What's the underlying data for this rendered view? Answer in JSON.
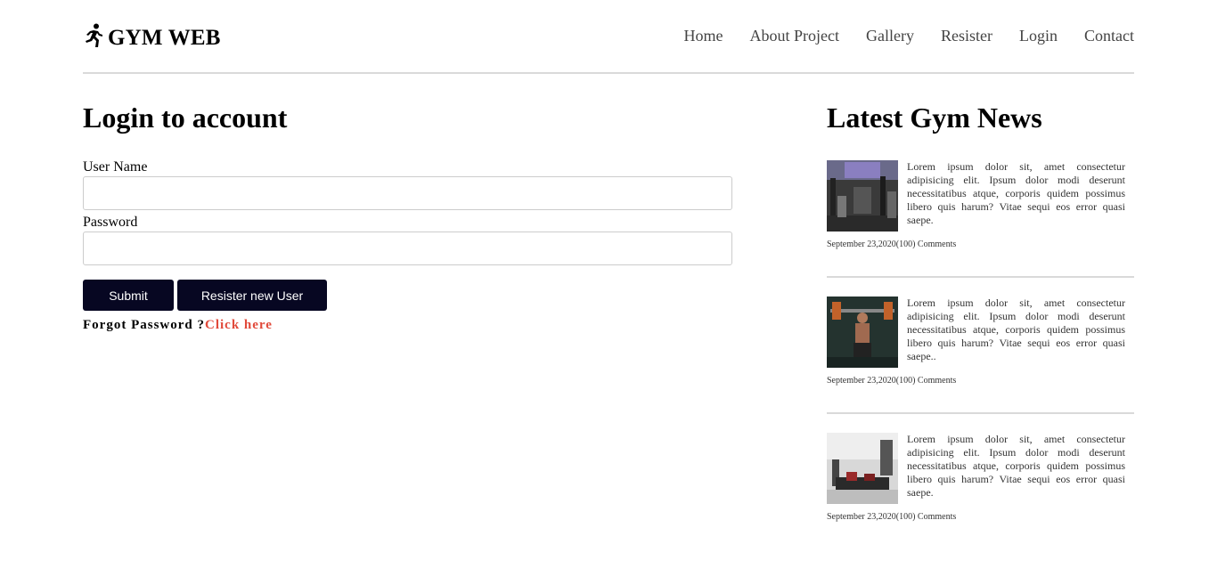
{
  "brand": {
    "name": "GYM WEB",
    "icon": "running-person-icon"
  },
  "nav": [
    {
      "label": "Home"
    },
    {
      "label": "About Project"
    },
    {
      "label": "Gallery"
    },
    {
      "label": "Resister"
    },
    {
      "label": "Login"
    },
    {
      "label": "Contact"
    }
  ],
  "login": {
    "title": "Login to account",
    "username_label": "User Name",
    "username_value": "",
    "password_label": "Password",
    "password_value": "",
    "submit_label": "Submit",
    "register_label": "Resister new User",
    "forgot_text": "Forgot Password ?",
    "forgot_link": "Click here"
  },
  "news": {
    "title": "Latest Gym News",
    "items": [
      {
        "text": "Lorem ipsum dolor sit, amet consectetur adipisicing elit. Ipsum dolor modi deserunt necessitatibus atque, corporis quidem possimus libero quis harum? Vitae sequi eos error quasi saepe.",
        "meta": "September 23,2020(100) Comments"
      },
      {
        "text": "Lorem ipsum dolor sit, amet consectetur adipisicing elit. Ipsum dolor modi deserunt necessitatibus atque, corporis quidem possimus libero quis harum? Vitae sequi eos error quasi saepe..",
        "meta": "September 23,2020(100) Comments"
      },
      {
        "text": "Lorem ipsum dolor sit, amet consectetur adipisicing elit. Ipsum dolor modi deserunt necessitatibus atque, corporis quidem possimus libero quis harum? Vitae sequi eos error quasi saepe.",
        "meta": "September 23,2020(100) Comments"
      }
    ]
  },
  "colors": {
    "button_bg": "#070722",
    "link_accent": "#e14a3b",
    "divider": "#d9d9d9"
  }
}
